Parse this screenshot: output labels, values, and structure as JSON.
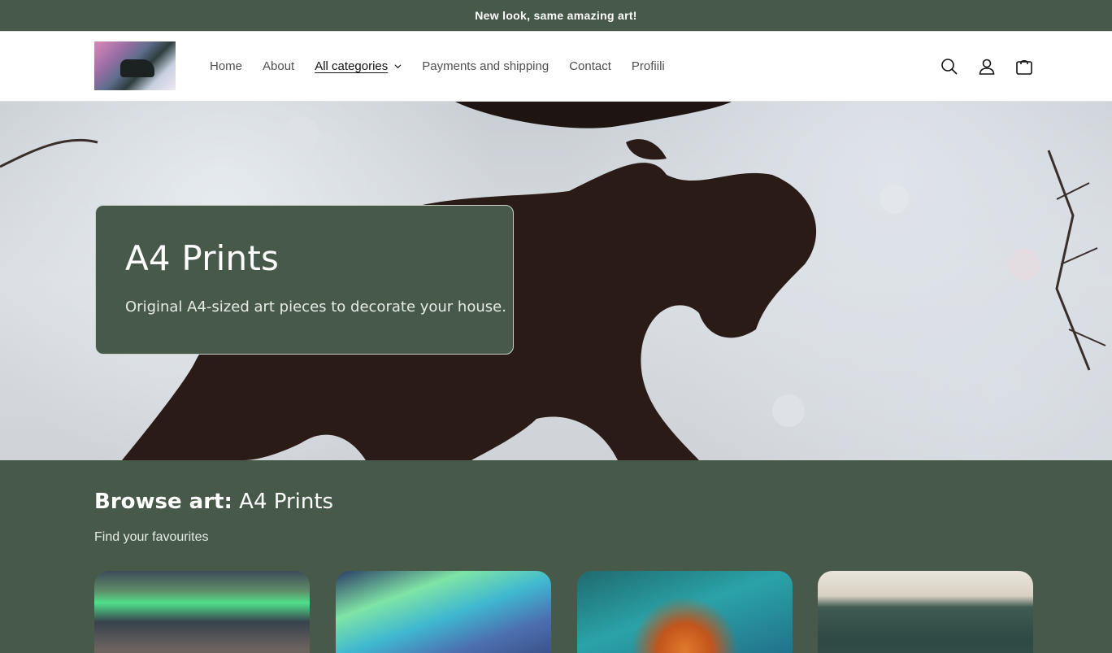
{
  "announcement": {
    "text": "New look, same amazing art!"
  },
  "header": {
    "logo_name": "store-logo",
    "nav": [
      {
        "label": "Home",
        "active": false
      },
      {
        "label": "About",
        "active": false
      },
      {
        "label": "All categories",
        "active": true,
        "has_dropdown": true
      },
      {
        "label": "Payments and shipping",
        "active": false
      },
      {
        "label": "Contact",
        "active": false
      },
      {
        "label": "Profiili",
        "active": false
      }
    ],
    "icons": [
      "search-icon",
      "account-icon",
      "cart-icon"
    ]
  },
  "hero": {
    "title": "A4 Prints",
    "subtitle": "Original A4-sized art pieces to decorate your house."
  },
  "browse": {
    "title_bold": "Browse art:",
    "title_rest": "A4 Prints",
    "subtitle": "Find your favourites"
  },
  "colors": {
    "brand_green": "#475a4a",
    "text": "#121212",
    "nav_text": "#4f4f4f"
  }
}
